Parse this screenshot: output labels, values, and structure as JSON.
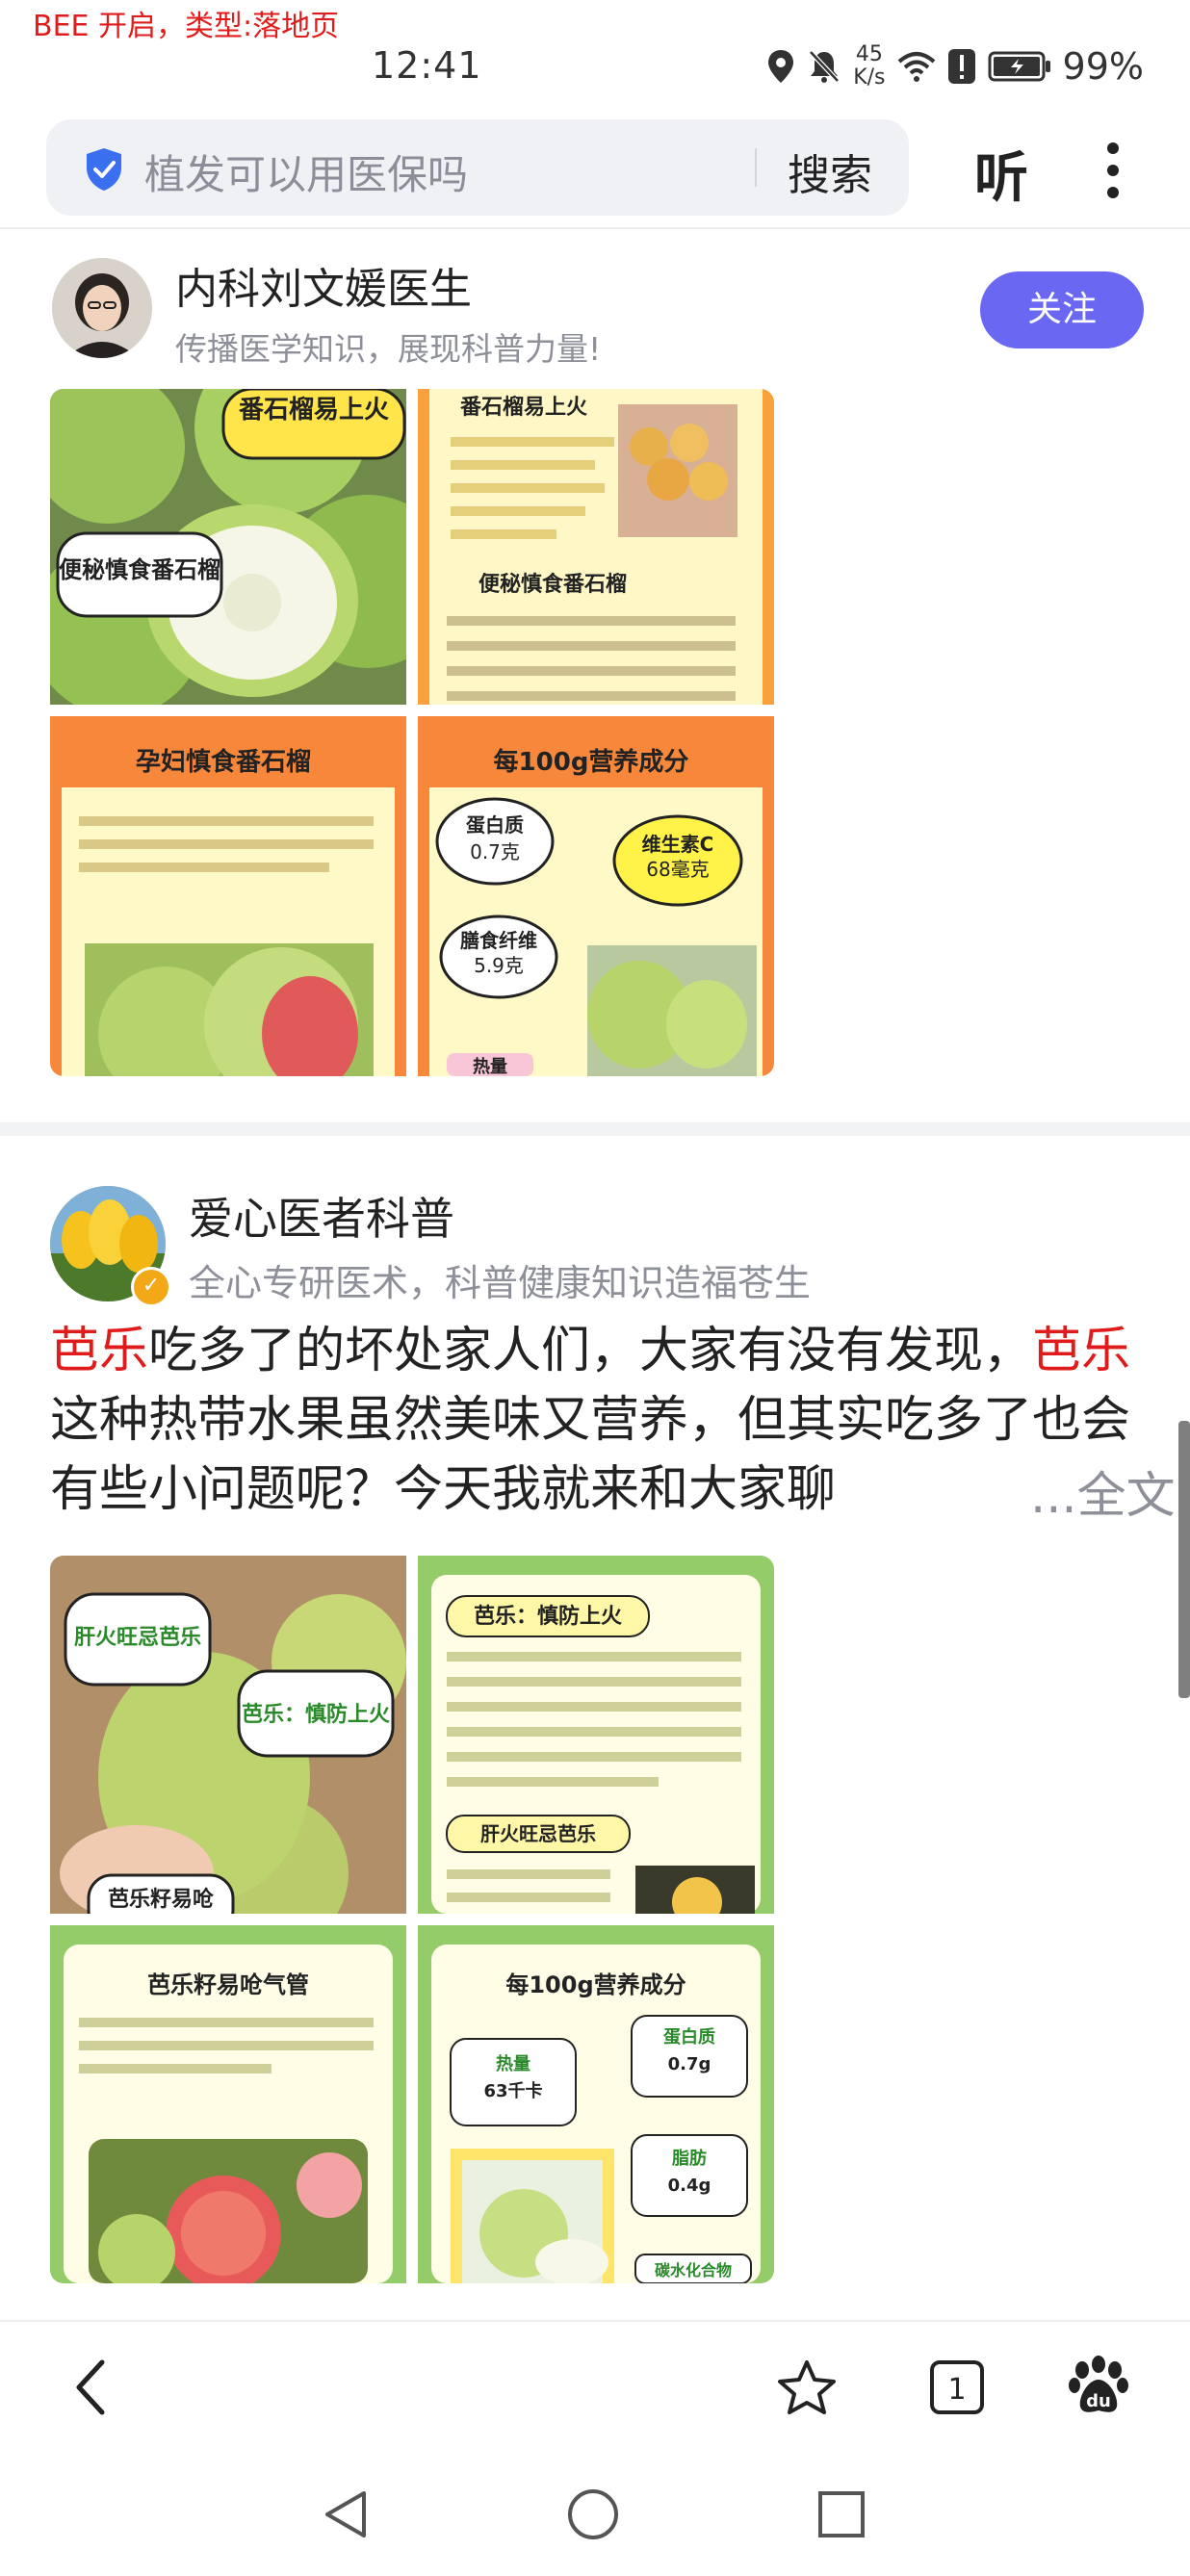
{
  "status_bar": {
    "bee_label": "BEE 开启，类型:落地页",
    "time": "12:41",
    "net_speed_value": "45",
    "net_speed_unit": "K/s",
    "battery": "99%"
  },
  "search": {
    "query": "植发可以用医保吗",
    "search_label": "搜索",
    "listen_label": "听"
  },
  "post1": {
    "author": "内科刘文媛医生",
    "description": "传播医学知识，展现科普力量!",
    "follow_label": "关注",
    "images": [
      {
        "tag": "番石榴易上火",
        "tag2": "便秘慎食番石榴"
      },
      {
        "title": "番石榴易上火",
        "section": "便秘慎食番石榴"
      },
      {
        "title": "孕妇慎食番石榴"
      },
      {
        "title": "每100g营养成分",
        "item1_label": "蛋白质",
        "item1_value": "0.7克",
        "item2_label": "维生素C",
        "item2_value": "68毫克",
        "item3_label": "膳食纤维",
        "item3_value": "5.9克",
        "item4_label": "热量"
      }
    ]
  },
  "post2": {
    "author": "爱心医者科普",
    "description": "全心专研医术，科普健康知识造福苍生",
    "text_kw1": "芭乐",
    "text_part1": "吃多了的坏处家人们，大家有没有发现，",
    "text_kw2": "芭乐",
    "text_part2": "这种热带水果虽然美味又营养，但其实吃多了也会有些小问题呢？今天我就来和大家聊",
    "more_label": "...全文",
    "images": [
      {
        "bubble1": "肝火旺忌芭乐",
        "bubble2": "芭乐：慎防上火",
        "bubble3": "芭乐籽易呛"
      },
      {
        "title": "芭乐：慎防上火",
        "section": "肝火旺忌芭乐"
      },
      {
        "title": "芭乐籽易呛气管"
      },
      {
        "title": "每100g营养成分",
        "item1_label": "热量",
        "item1_value": "63千卡",
        "item2_label": "蛋白质",
        "item2_value": "0.7g",
        "item3_label": "脂肪",
        "item3_value": "0.4g",
        "item4_label": "碳水化合物"
      }
    ]
  }
}
